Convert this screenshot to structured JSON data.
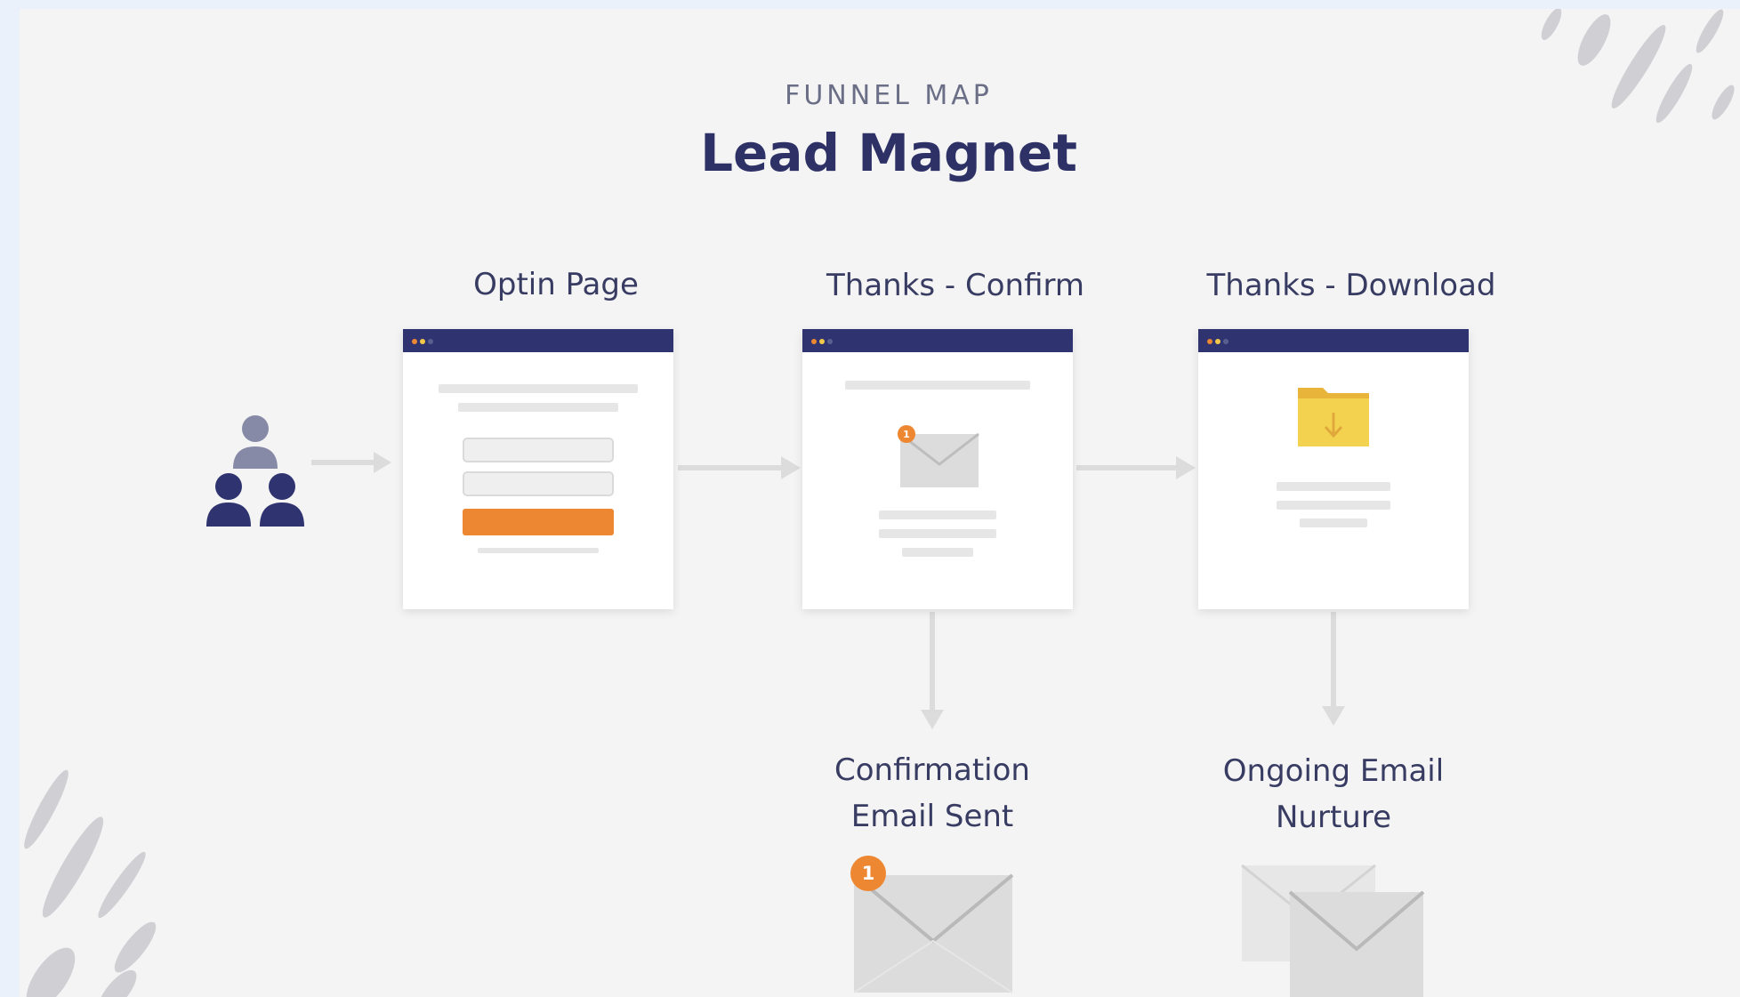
{
  "header": {
    "eyebrow": "FUNNEL MAP",
    "title": "Lead Magnet"
  },
  "steps": [
    {
      "label": "Optin Page"
    },
    {
      "label": "Thanks - Confirm"
    },
    {
      "label": "Thanks - Download"
    }
  ],
  "outcomes": [
    {
      "line1": "Confirmation",
      "line2": "Email Sent",
      "badge": "1"
    },
    {
      "line1": "Ongoing Email",
      "line2": "Nurture"
    }
  ],
  "confirm_card": {
    "badge": "1"
  },
  "colors": {
    "navy": "#2f3470",
    "title": "#2d3166",
    "accent_orange": "#ee8732",
    "folder_yellow": "#f3c94a",
    "arrow_gray": "#dcdcdc",
    "background": "#f4f4f4"
  },
  "icons": {
    "audience": "people-group-icon",
    "envelope": "envelope-icon",
    "folder": "download-folder-icon",
    "stroke": "brush-stroke-decoration"
  }
}
